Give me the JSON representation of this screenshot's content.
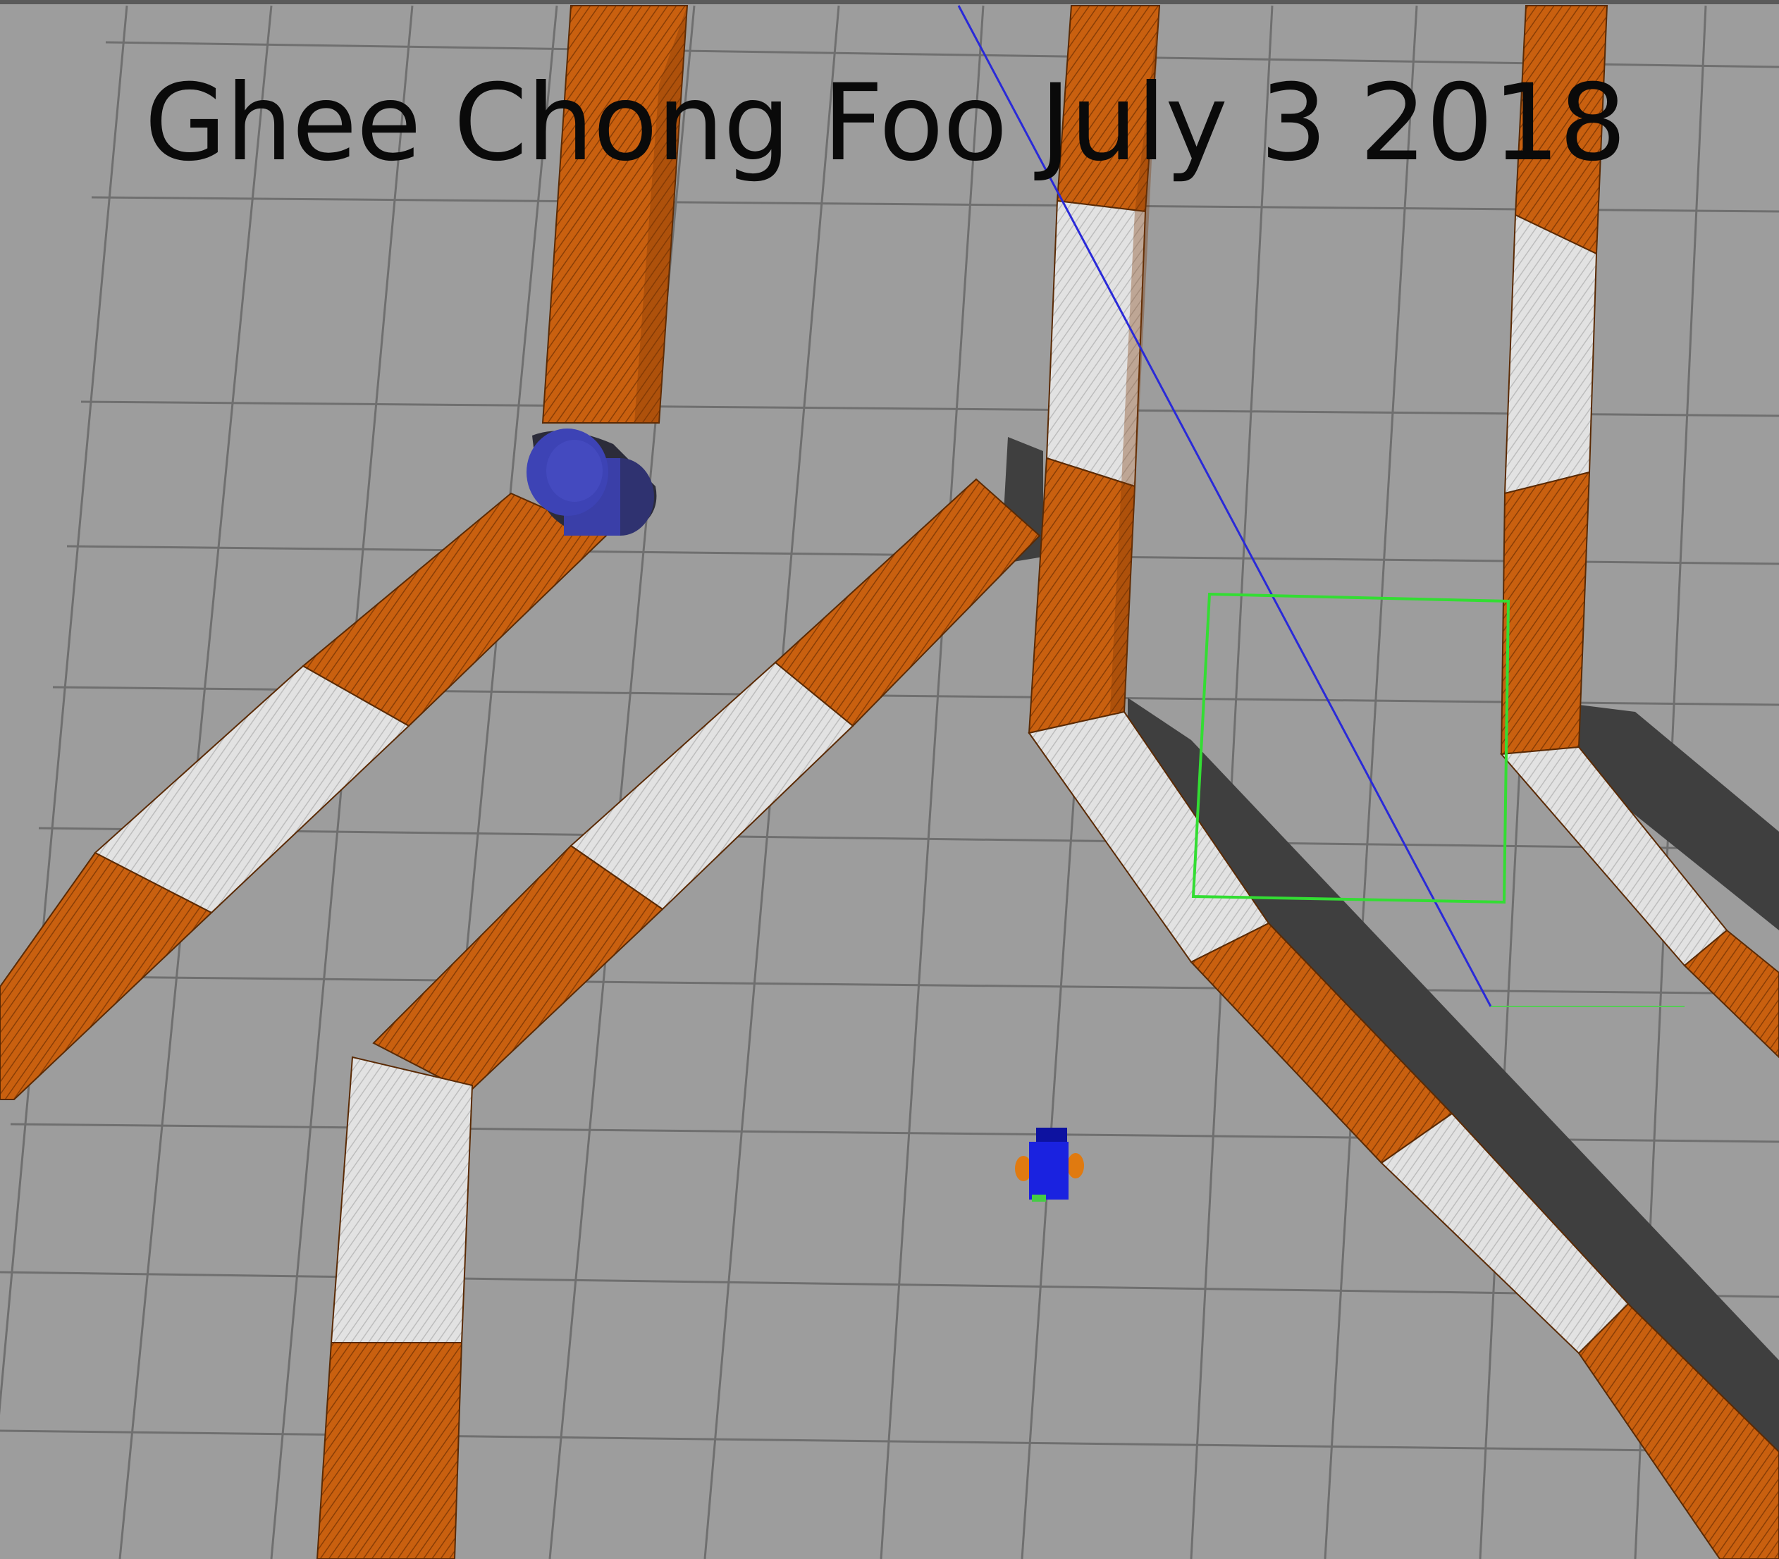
{
  "overlay": {
    "caption": "Ghee Chong Foo July 3 2018"
  },
  "scene": {
    "type": "3d-simulation-viewport",
    "colors": {
      "ground": "#9d9d9d",
      "grid_line": "#6f6f6f",
      "wall_orange": "#c9600f",
      "wall_orange_dark": "#7a3605",
      "wall_white": "#e2e2e2",
      "wall_white_dark": "#a9a9a9",
      "shadow": "#3f3f3f",
      "cylinder": "#3a3fa8",
      "laser_ray": "#2a2ad8",
      "goal_box": "#33dd33",
      "robot_body": "#1a22e0",
      "robot_wheel": "#e07a10"
    },
    "icons": [
      "robot-icon",
      "cylinder-obstacle-icon"
    ]
  }
}
